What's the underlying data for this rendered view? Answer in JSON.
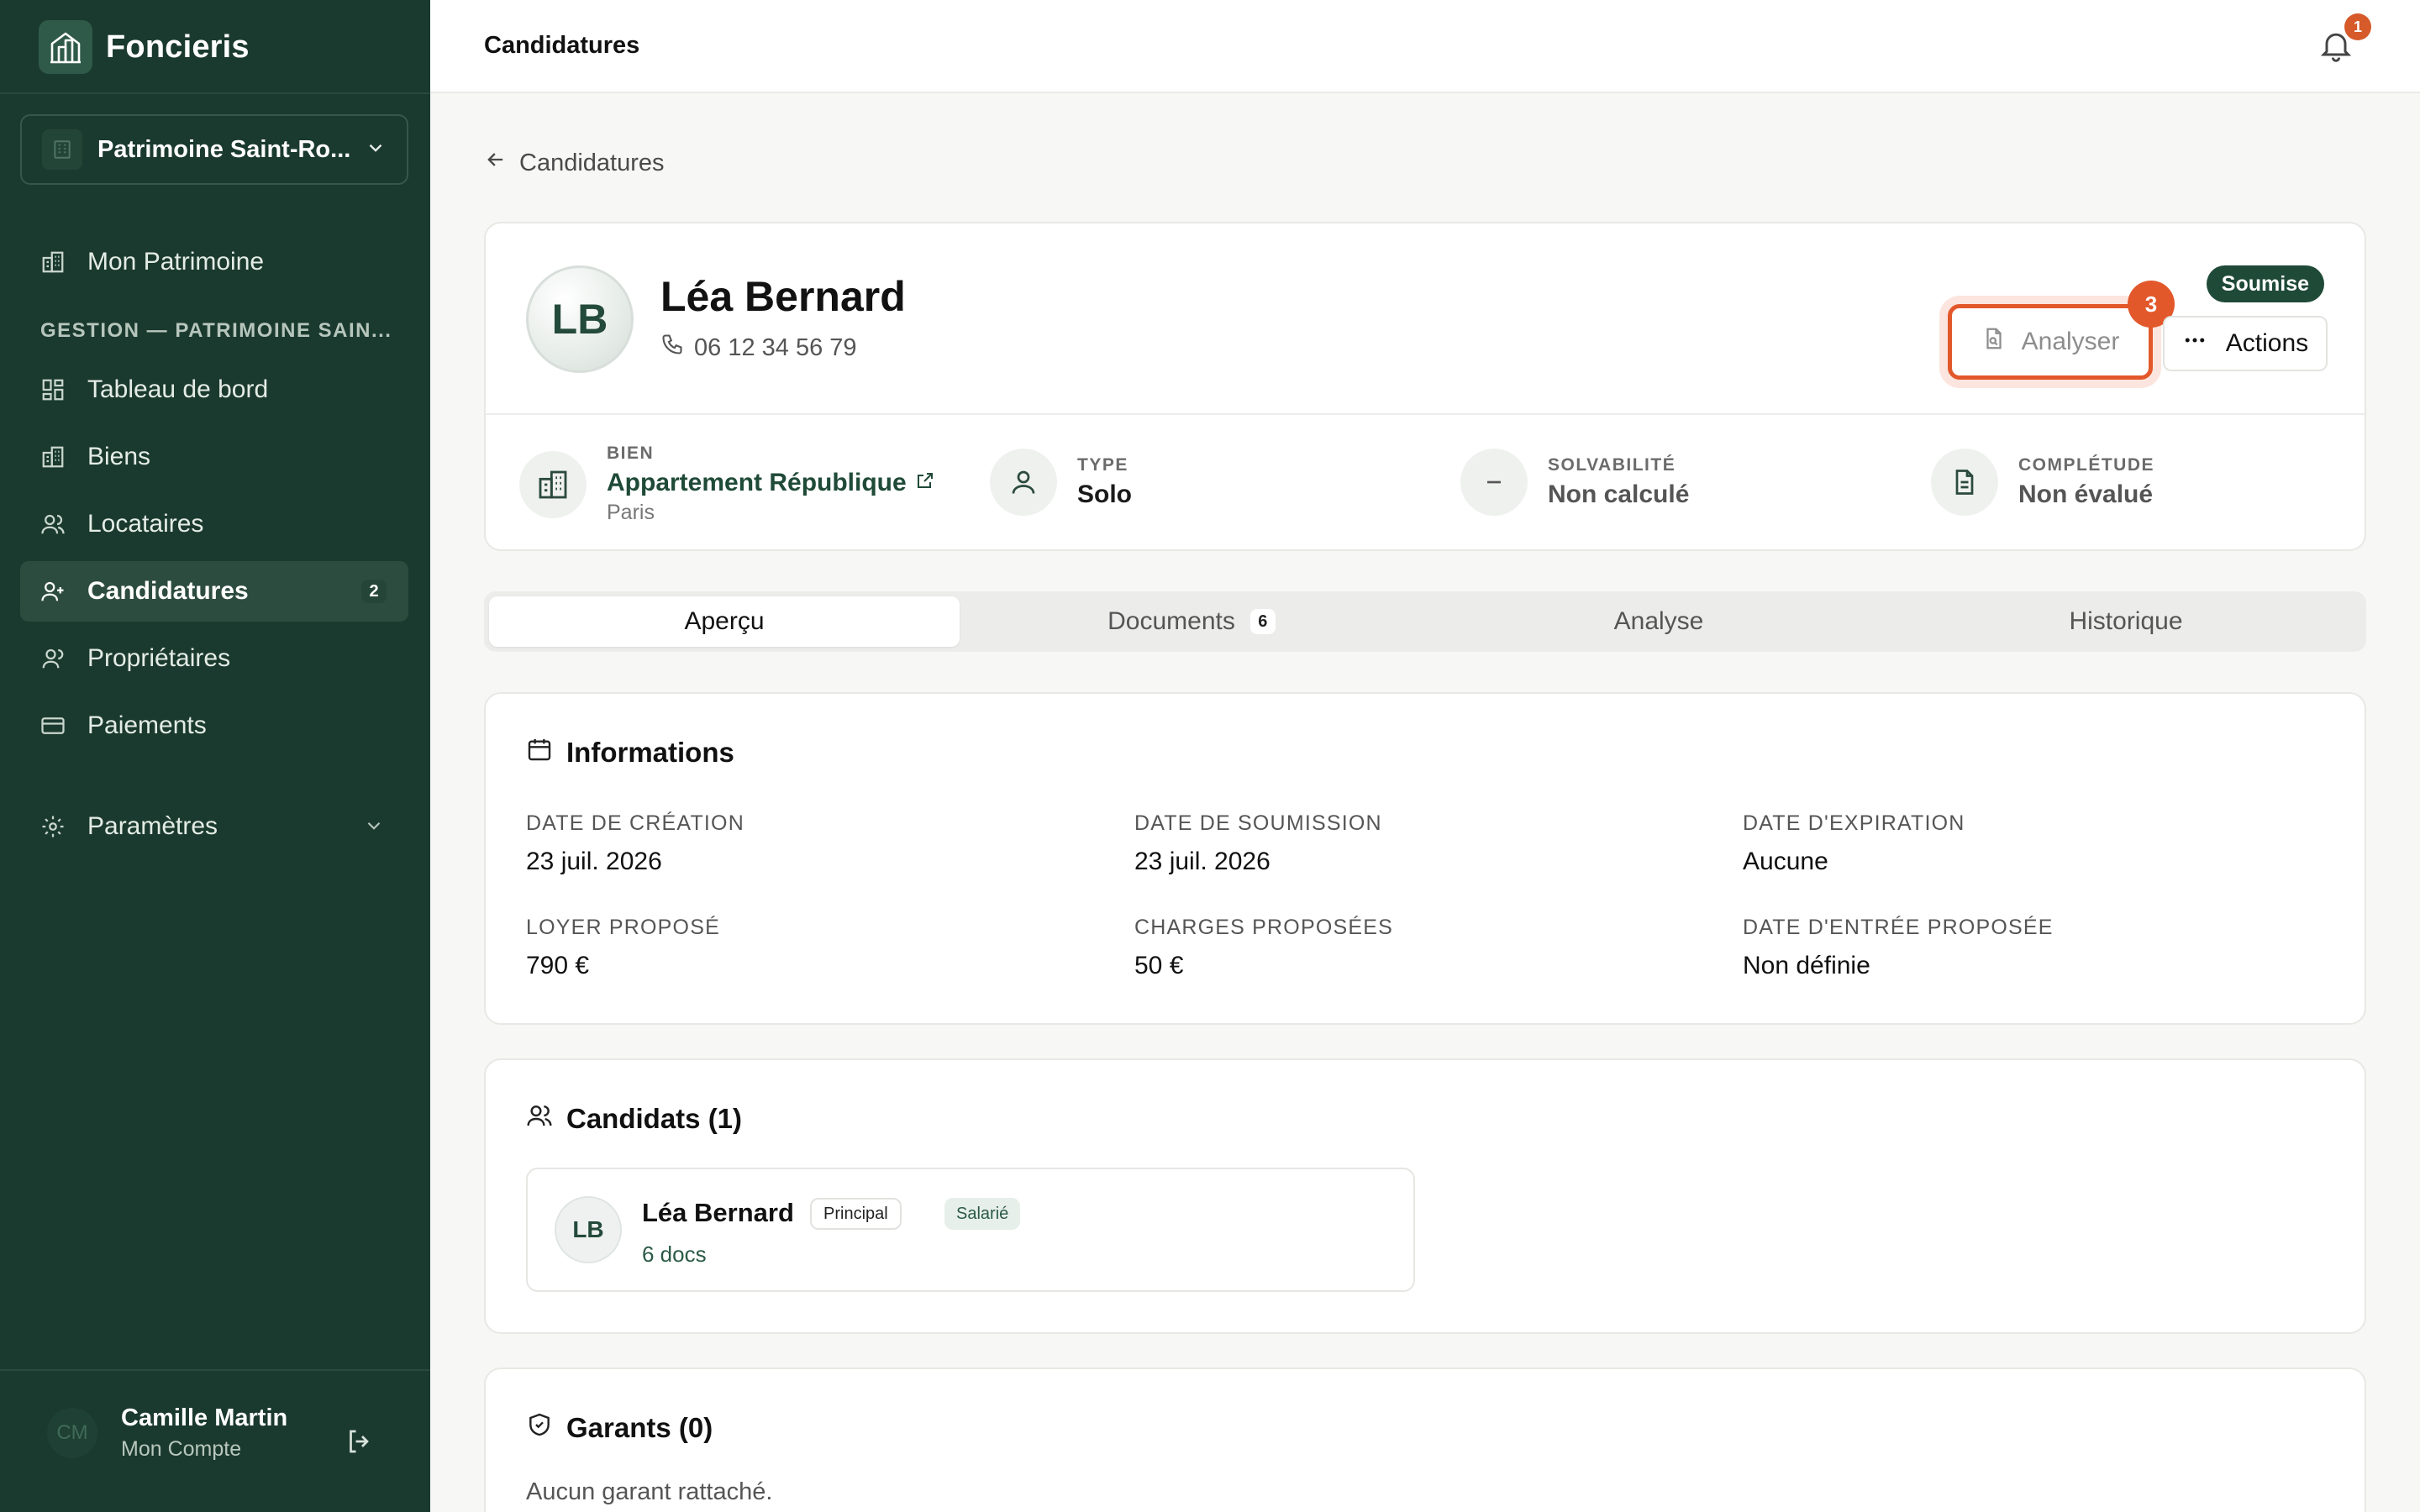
{
  "app": {
    "name": "Foncieris"
  },
  "workspace": {
    "label": "Patrimoine Saint-Ro..."
  },
  "sidebar": {
    "top_item": {
      "label": "Mon Patrimoine"
    },
    "section_label": "GESTION — PATRIMOINE SAIN...",
    "items": [
      {
        "label": "Tableau de bord"
      },
      {
        "label": "Biens"
      },
      {
        "label": "Locataires"
      },
      {
        "label": "Candidatures",
        "badge": "2",
        "active": true
      },
      {
        "label": "Propriétaires"
      },
      {
        "label": "Paiements"
      }
    ],
    "settings": {
      "label": "Paramètres"
    },
    "user": {
      "initials": "CM",
      "name": "Camille Martin",
      "sub": "Mon Compte"
    }
  },
  "topbar": {
    "title": "Candidatures",
    "notifications": "1"
  },
  "breadcrumb": {
    "back_label": "Candidatures"
  },
  "candidate": {
    "initials": "LB",
    "name": "Léa Bernard",
    "phone": "06 12 34 56 79",
    "status": "Soumise",
    "analyse_label": "Analyser",
    "analyse_count": "3",
    "actions_label": "Actions"
  },
  "meta": {
    "bien": {
      "label": "BIEN",
      "value": "Appartement République",
      "sub": "Paris"
    },
    "type": {
      "label": "TYPE",
      "value": "Solo"
    },
    "solvabilite": {
      "label": "SOLVABILITÉ",
      "value": "Non calculé"
    },
    "completude": {
      "label": "COMPLÉTUDE",
      "value": "Non évalué"
    }
  },
  "tabs": [
    {
      "label": "Aperçu",
      "active": true
    },
    {
      "label": "Documents",
      "count": "6"
    },
    {
      "label": "Analyse"
    },
    {
      "label": "Historique"
    }
  ],
  "informations": {
    "title": "Informations",
    "fields": [
      {
        "label": "DATE DE CRÉATION",
        "value": "23 juil. 2026"
      },
      {
        "label": "DATE DE SOUMISSION",
        "value": "23 juil. 2026"
      },
      {
        "label": "DATE D'EXPIRATION",
        "value": "Aucune"
      },
      {
        "label": "LOYER PROPOSÉ",
        "value": "790 €"
      },
      {
        "label": "CHARGES PROPOSÉES",
        "value": "50 €"
      },
      {
        "label": "DATE D'ENTRÉE PROPOSÉE",
        "value": "Non définie"
      }
    ]
  },
  "candidats": {
    "title": "Candidats (1)",
    "items": [
      {
        "initials": "LB",
        "name": "Léa Bernard",
        "role": "Principal",
        "status": "Salarié",
        "docs": "6 docs"
      }
    ]
  },
  "garants": {
    "title": "Garants (0)",
    "empty": "Aucun garant rattaché."
  },
  "colors": {
    "sidebar": "#1b3a2f",
    "accent": "#1f4a38",
    "highlight": "#e2582b"
  }
}
